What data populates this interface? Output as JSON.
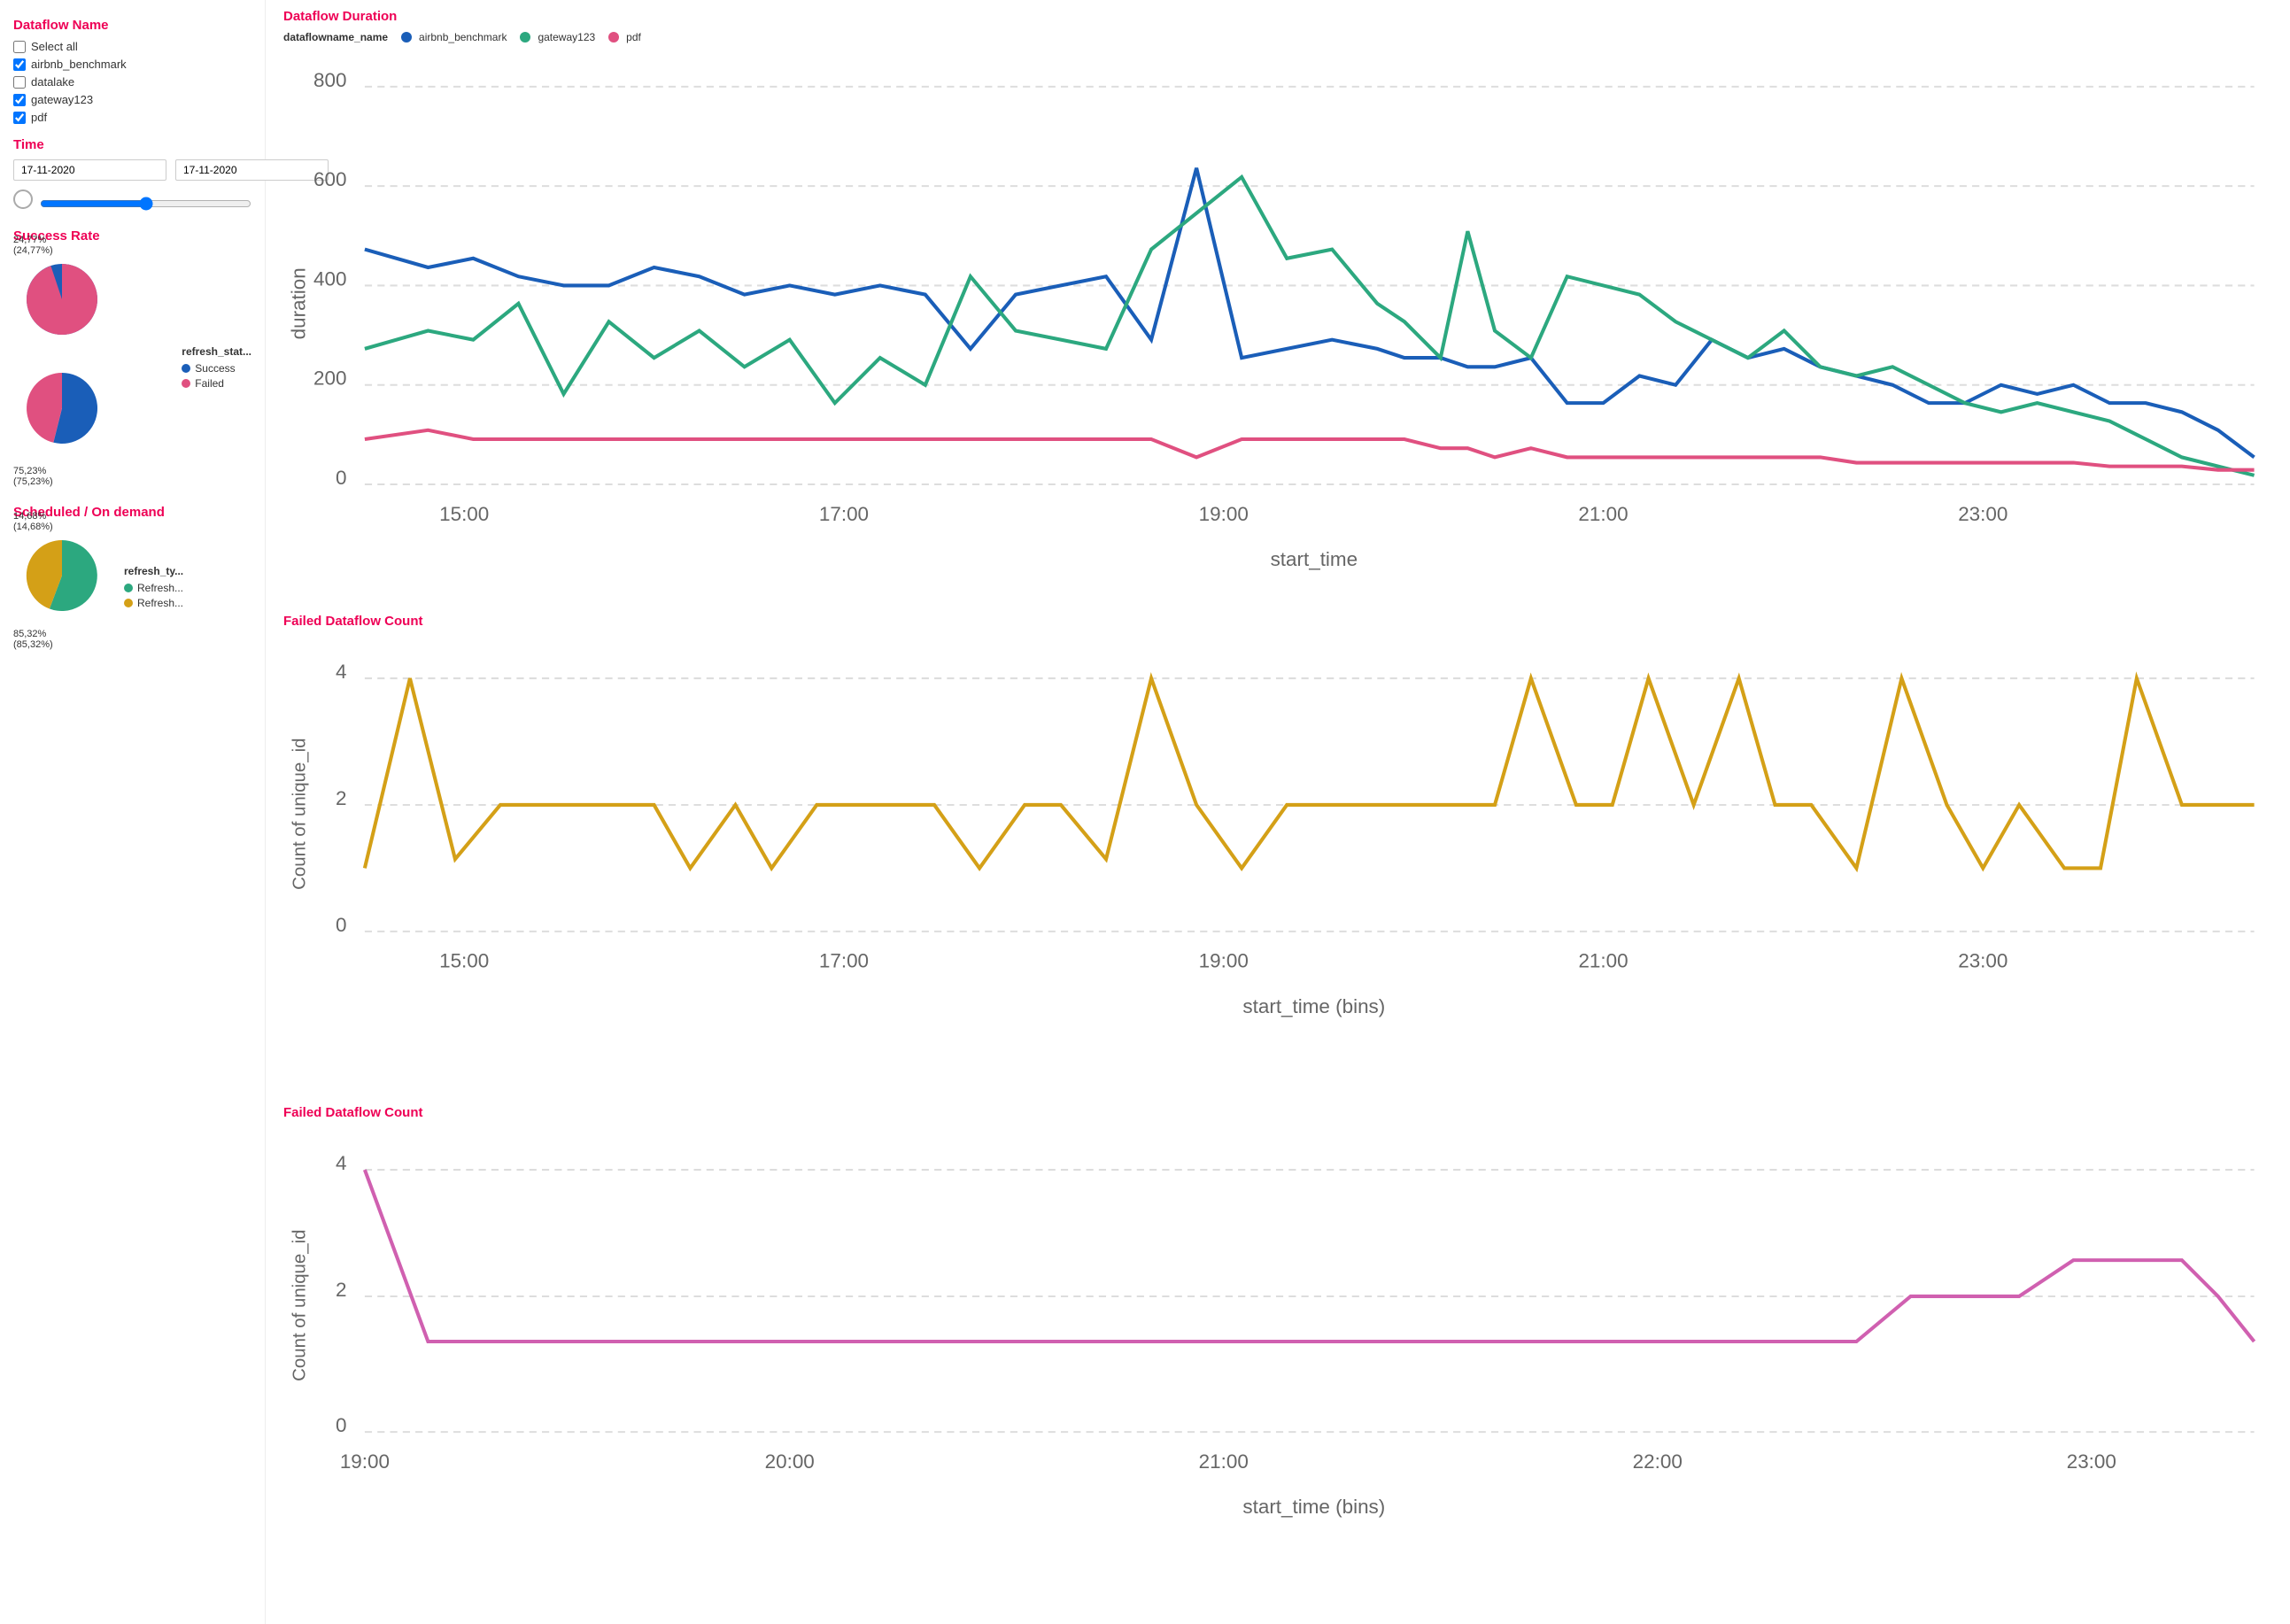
{
  "sidebar": {
    "dataflow_title": "Dataflow Name",
    "select_all_label": "Select all",
    "checkboxes": [
      {
        "id": "airbnb",
        "label": "airbnb_benchmark",
        "checked": true
      },
      {
        "id": "datalake",
        "label": "datalake",
        "checked": false
      },
      {
        "id": "gateway",
        "label": "gateway123",
        "checked": true
      },
      {
        "id": "pdf",
        "label": "pdf",
        "checked": true
      }
    ],
    "time_title": "Time",
    "date_start": "17-11-2020",
    "date_end": "17-11-2020",
    "success_rate_title": "Success Rate",
    "pie_legend_title_1": "refresh_stat...",
    "success_label": "Success",
    "failed_label": "Failed",
    "success_pct": "75,23%",
    "success_pct2": "(75,23%)",
    "failed_pct": "24,77%",
    "failed_pct2": "(24,77%)",
    "scheduled_title": "Scheduled / On demand",
    "pie_legend_title_2": "refresh_ty...",
    "refresh1_label": "Refresh...",
    "refresh2_label": "Refresh...",
    "refresh1_pct": "85,32%",
    "refresh1_pct2": "(85,32%)",
    "refresh2_pct": "14,68%",
    "refresh2_pct2": "(14,68%)"
  },
  "charts": {
    "duration_title": "Dataflow Duration",
    "legend_title": "dataflowname_name",
    "legend_items": [
      {
        "label": "airbnb_benchmark",
        "color": "#1a5eb8"
      },
      {
        "label": "gateway123",
        "color": "#2ca87f"
      },
      {
        "label": "pdf",
        "color": "#e05080"
      }
    ],
    "duration_y_label": "duration",
    "duration_x_label": "start_time",
    "failed_count_title": "Failed Dataflow Count",
    "failed_count_x_label": "start_time (bins)",
    "failed_count_y_label": "Count of unique_id",
    "failed_count2_title": "Failed Dataflow Count",
    "failed_count2_x_label": "start_time (bins)",
    "failed_count2_y_label": "Count of unique_id"
  }
}
